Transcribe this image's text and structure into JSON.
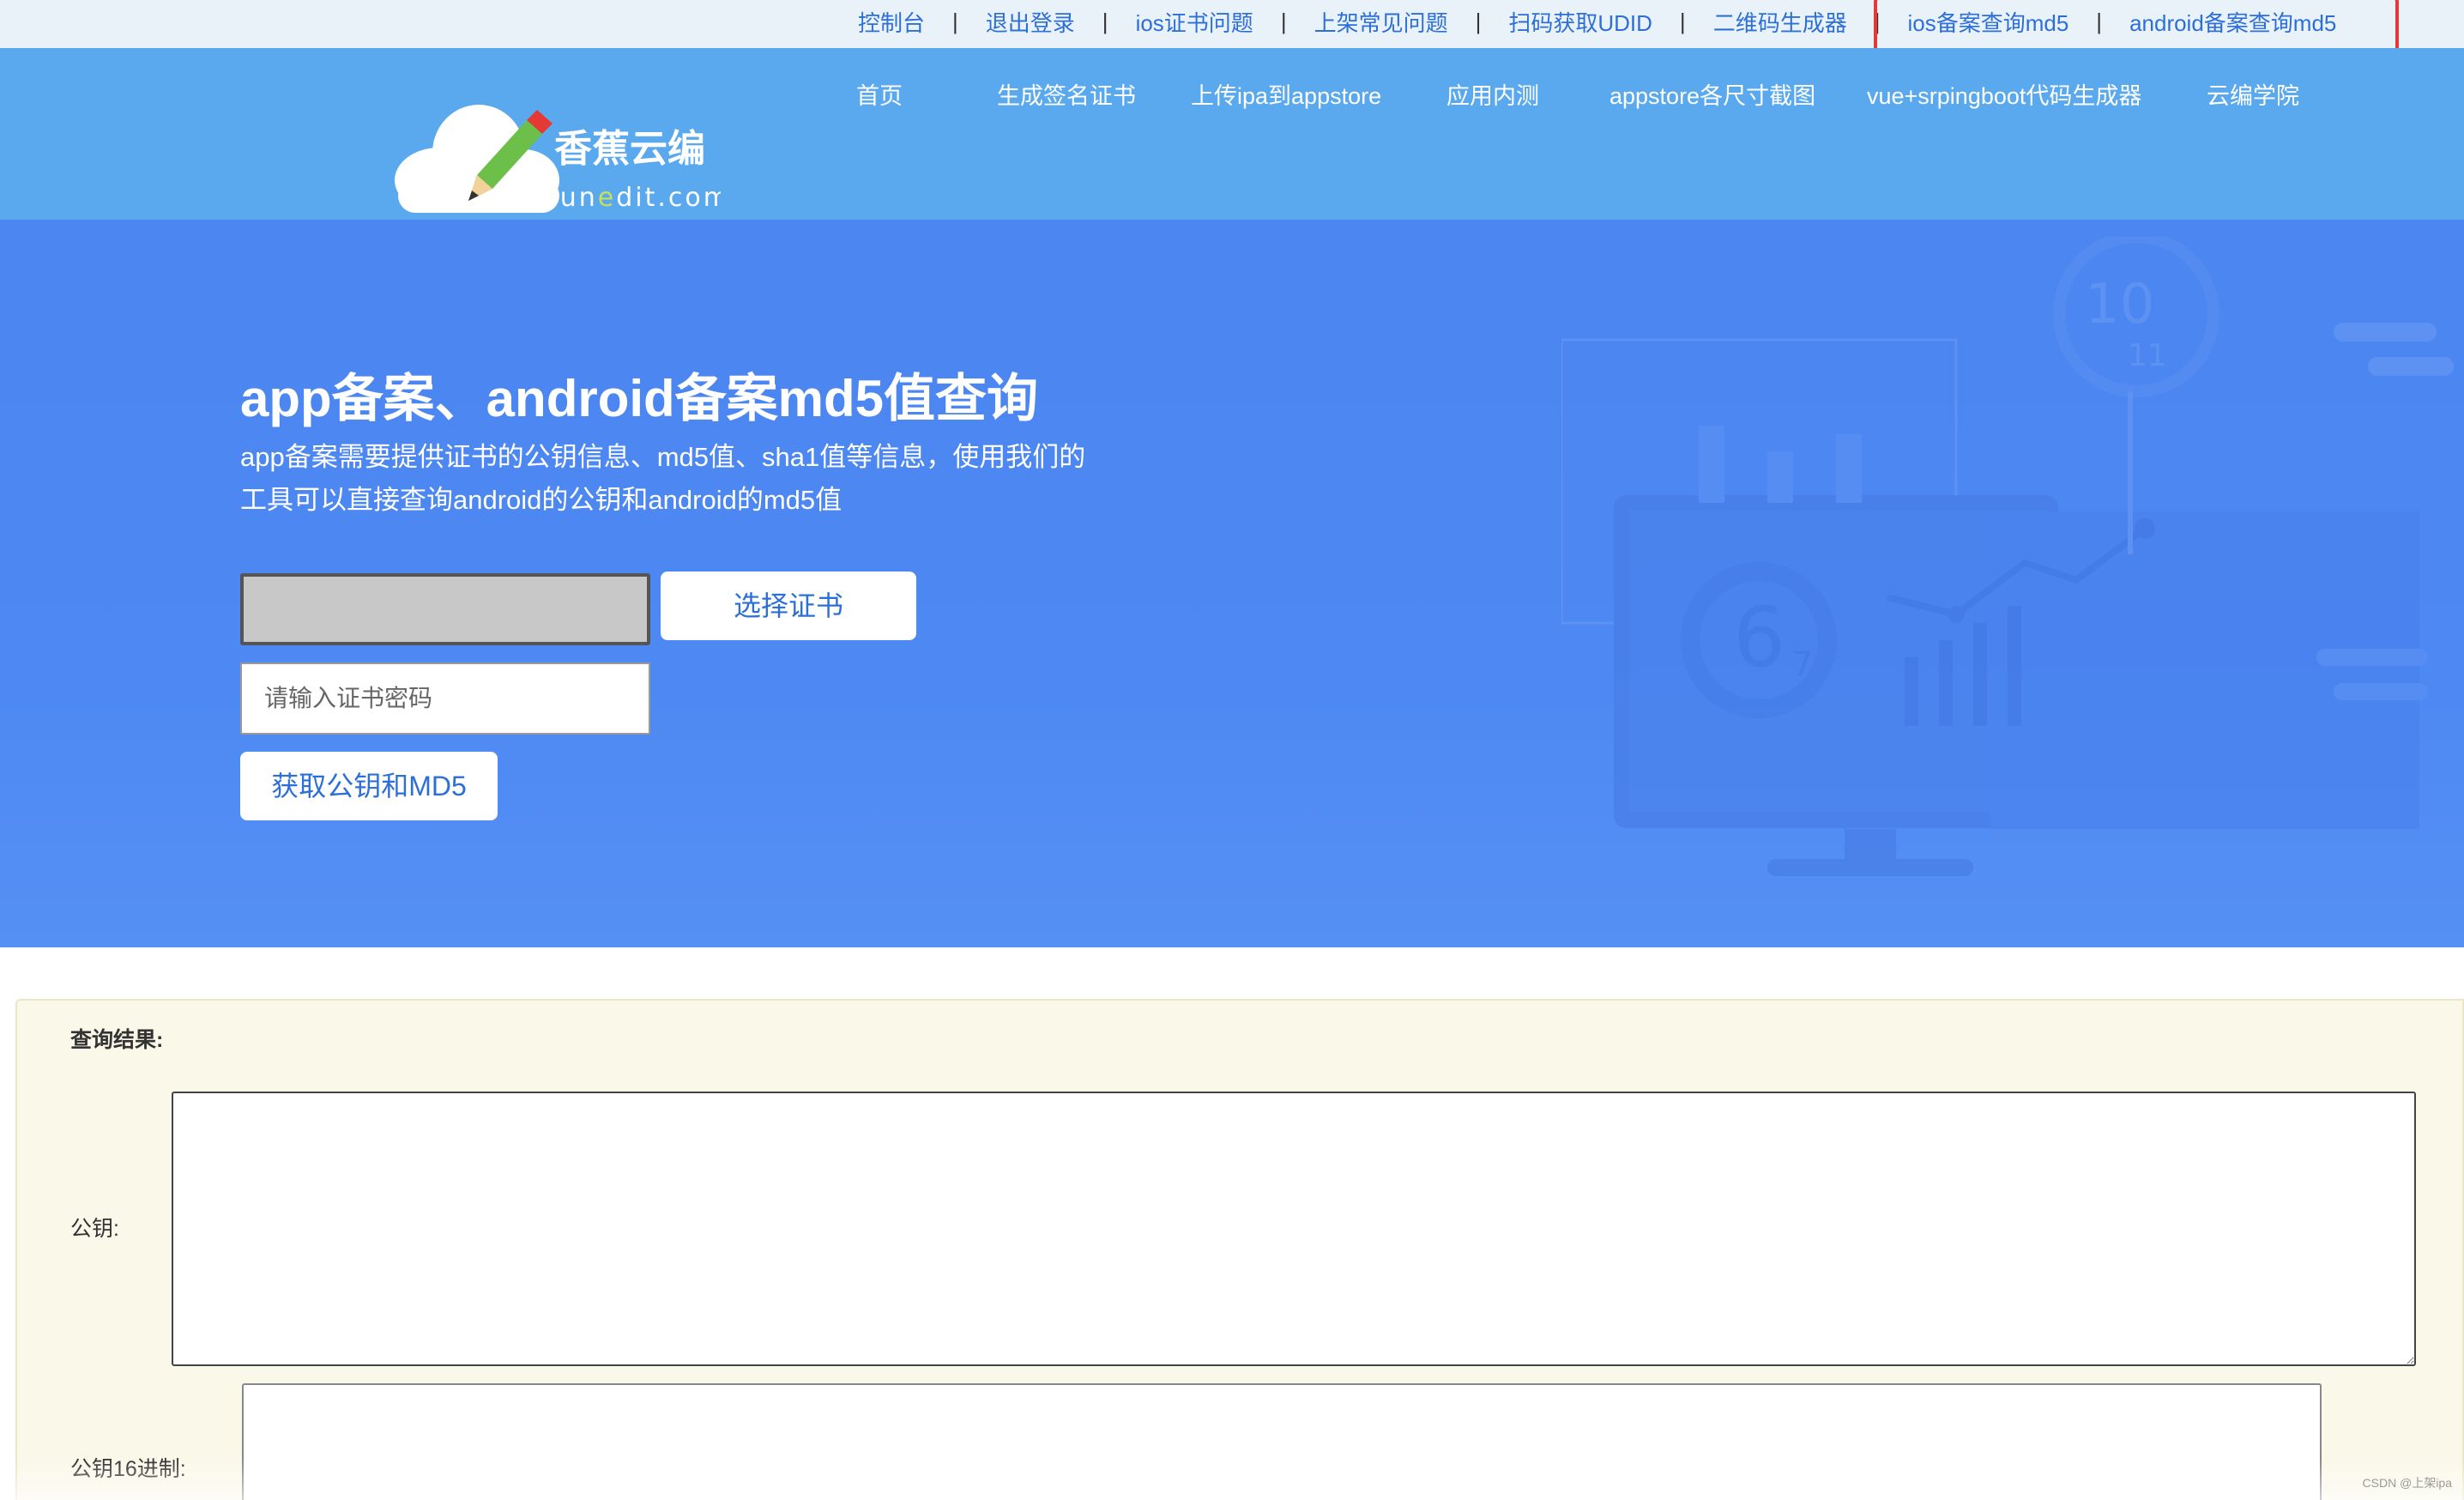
{
  "topbar": {
    "links": [
      "控制台",
      "退出登录",
      "ios证书问题",
      "上架常见问题",
      "扫码获取UDID",
      "二维码生成器",
      "ios备案查询md5",
      "android备案查询md5"
    ],
    "separator": "|"
  },
  "logo": {
    "name_cn": "香蕉云编",
    "domain_pre": "yun",
    "domain_accent": "e",
    "domain_post": "dit.com"
  },
  "nav": {
    "items": [
      "首页",
      "生成签名证书",
      "上传ipa到appstore",
      "应用内测",
      "appstore各尺寸截图",
      "vue+srpingboot代码生成器",
      "云编学院"
    ]
  },
  "hero": {
    "title": "app备案、android备案md5值查询",
    "desc": "app备案需要提供证书的公钥信息、md5值、sha1值等信息，使用我们的工具可以直接查询android的公钥和android的md5值",
    "choose_button": "选择证书",
    "password_placeholder": "请输入证书密码",
    "get_button": "获取公钥和MD5",
    "deco_numbers": [
      "10",
      "11",
      "6",
      "7"
    ]
  },
  "result": {
    "title": "查询结果:",
    "pubkey_label": "公钥:",
    "pubkey_value": "",
    "hex_label": "公钥16进制:",
    "hex_value": ""
  },
  "watermark": "CSDN @上架ipa",
  "colors": {
    "topbar_bg": "#eaf2f9",
    "navbar_bg": "#5aa9ee",
    "hero_bg": "#4c86f0",
    "link": "#2d6fd9",
    "result_bg": "#faf8e8",
    "highlight": "#e53935"
  }
}
